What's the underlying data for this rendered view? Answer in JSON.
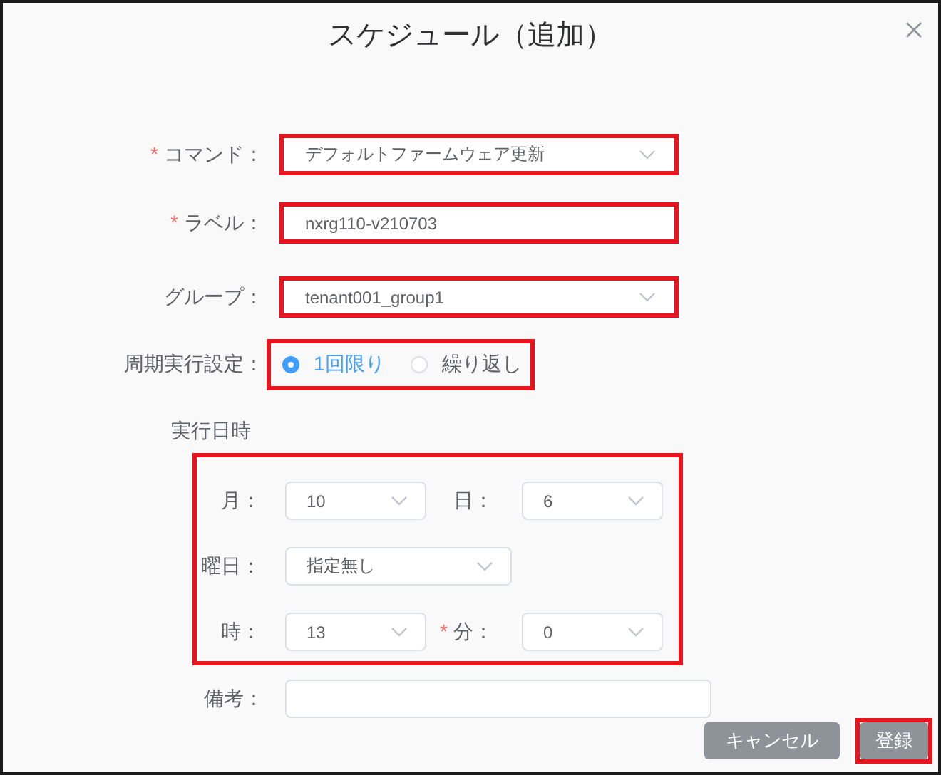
{
  "dialog": {
    "title": "スケジュール（追加）"
  },
  "fields": [
    {
      "kind": "select",
      "mark": "*",
      "label": "コマンド：",
      "value": "デフォルトファームウェア更新",
      "highlighted": true
    },
    {
      "kind": "input",
      "mark": "*",
      "label": "ラベル：",
      "value": "nxrg110-v210703",
      "highlighted": true
    },
    {
      "kind": "select",
      "label": "グループ：",
      "value": "tenant001_group1",
      "highlighted": true
    }
  ],
  "periodic": {
    "label": "周期実行設定：",
    "highlighted": true,
    "options": [
      {
        "label": "1回限り",
        "selected": true
      },
      {
        "label": "繰り返し",
        "selected": false
      }
    ]
  },
  "schedule": {
    "heading": "実行日時",
    "highlighted": true,
    "rows": [
      [
        {
          "label": "月：",
          "value": "10",
          "kind": "narrow"
        },
        {
          "label": "日：",
          "value": "6",
          "kind": "narrow"
        }
      ],
      [
        {
          "label": "曜日：",
          "value": "指定無し",
          "kind": "wide"
        }
      ],
      [
        {
          "label": "時：",
          "value": "13",
          "kind": "narrow"
        },
        {
          "mark": "*",
          "label": "分：",
          "value": "0",
          "kind": "narrow"
        }
      ]
    ]
  },
  "note": {
    "label": "備考："
  },
  "buttons": [
    {
      "label": "キャンセル",
      "highlighted": false
    },
    {
      "label": "登録",
      "highlighted": true
    }
  ]
}
